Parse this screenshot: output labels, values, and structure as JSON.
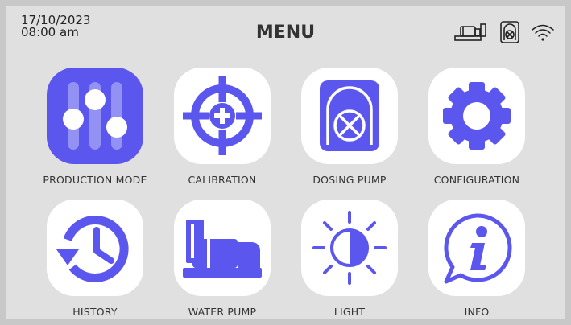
{
  "header": {
    "date": "17/10/2023",
    "time": "08:00 am",
    "title": "MENU"
  },
  "status_icons": [
    "water-pump-status-icon",
    "dosing-pump-status-icon",
    "wifi-icon"
  ],
  "menu": [
    {
      "id": "production-mode",
      "label": "PRODUCTION MODE",
      "icon": "sliders-icon"
    },
    {
      "id": "calibration",
      "label": "CALIBRATION",
      "icon": "crosshair-icon"
    },
    {
      "id": "dosing-pump",
      "label": "DOSING PUMP",
      "icon": "dosing-pump-icon"
    },
    {
      "id": "configuration",
      "label": "CONFIGURATION",
      "icon": "gear-icon"
    },
    {
      "id": "history",
      "label": "HISTORY",
      "icon": "history-clock-icon"
    },
    {
      "id": "water-pump",
      "label": "WATER PUMP",
      "icon": "water-pump-icon"
    },
    {
      "id": "light",
      "label": "LIGHT",
      "icon": "brightness-icon"
    },
    {
      "id": "info",
      "label": "INFO",
      "icon": "info-icon"
    }
  ],
  "colors": {
    "accent": "#5b57ee",
    "tile_bg": "#ffffff",
    "screen_bg": "#e0e0e0"
  }
}
